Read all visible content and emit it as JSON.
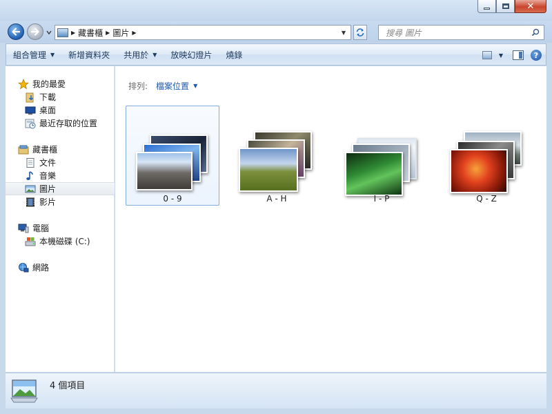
{
  "navigation": {
    "breadcrumbs": [
      "藏書櫃",
      "圖片"
    ],
    "search_placeholder": "搜尋 圖片"
  },
  "toolbar": {
    "organize": "組合管理",
    "new_folder": "新增資料夾",
    "share_with": "共用於",
    "slideshow": "放映幻燈片",
    "burn": "燒錄"
  },
  "sidebar": {
    "favorites": {
      "label": "我的最愛",
      "items": [
        {
          "label": "下載",
          "icon": "downloads-folder-icon"
        },
        {
          "label": "桌面",
          "icon": "desktop-icon"
        },
        {
          "label": "最近存取的位置",
          "icon": "recent-places-icon"
        }
      ]
    },
    "libraries": {
      "label": "藏書櫃",
      "items": [
        {
          "label": "文件",
          "icon": "documents-icon"
        },
        {
          "label": "音樂",
          "icon": "music-icon"
        },
        {
          "label": "圖片",
          "icon": "pictures-icon",
          "selected": true
        },
        {
          "label": "影片",
          "icon": "videos-icon"
        }
      ]
    },
    "computer": {
      "label": "電腦",
      "items": [
        {
          "label": "本機磁碟 (C:)",
          "icon": "local-disk-icon"
        }
      ]
    },
    "network": {
      "label": "網路"
    }
  },
  "content": {
    "sort_label": "排列:",
    "sort_value": "檔案位置",
    "folders": [
      {
        "label": "0 - 9",
        "selected": true
      },
      {
        "label": "A - H",
        "selected": false
      },
      {
        "label": "I - P",
        "selected": false
      },
      {
        "label": "Q - Z",
        "selected": false
      }
    ]
  },
  "status": {
    "item_count": "4 個項目"
  },
  "colors": {
    "accent": "#1e58b0",
    "selection_border": "#84acdd",
    "frame": "#c9d9ec"
  }
}
